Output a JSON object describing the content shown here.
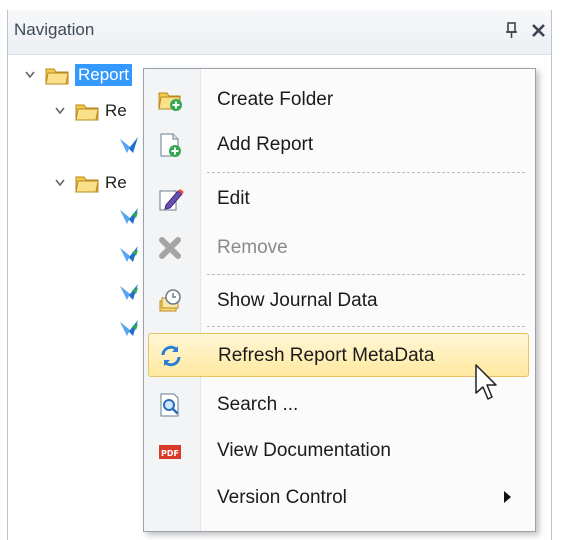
{
  "panel": {
    "title": "Navigation",
    "pin_glyph": "ṗ",
    "close_glyph": "✕"
  },
  "tree": {
    "root_label": "Reports",
    "root_label_visible": "Report",
    "child1_label": "Re",
    "child2_label": "Re"
  },
  "menu": {
    "items": [
      {
        "label": "Create Folder",
        "icon": "create-folder-icon",
        "enabled": true
      },
      {
        "label": "Add Report",
        "icon": "add-report-icon",
        "enabled": true
      },
      {
        "label": "Edit",
        "icon": "edit-icon",
        "enabled": true
      },
      {
        "label": "Remove",
        "icon": "remove-icon",
        "enabled": false
      },
      {
        "label": "Show Journal Data",
        "icon": "journal-icon",
        "enabled": true
      },
      {
        "label": "Refresh Report MetaData",
        "icon": "refresh-icon",
        "enabled": true,
        "highlighted": true
      },
      {
        "label": "Search ...",
        "icon": "search-icon",
        "enabled": true
      },
      {
        "label": "View Documentation",
        "icon": "pdf-icon",
        "enabled": true
      },
      {
        "label": "Version Control",
        "icon": "",
        "enabled": true,
        "has_submenu": true
      }
    ]
  },
  "colors": {
    "selection": "#3399ff",
    "highlight_bg": "#ffe9a0",
    "highlight_border": "#e5c365"
  }
}
